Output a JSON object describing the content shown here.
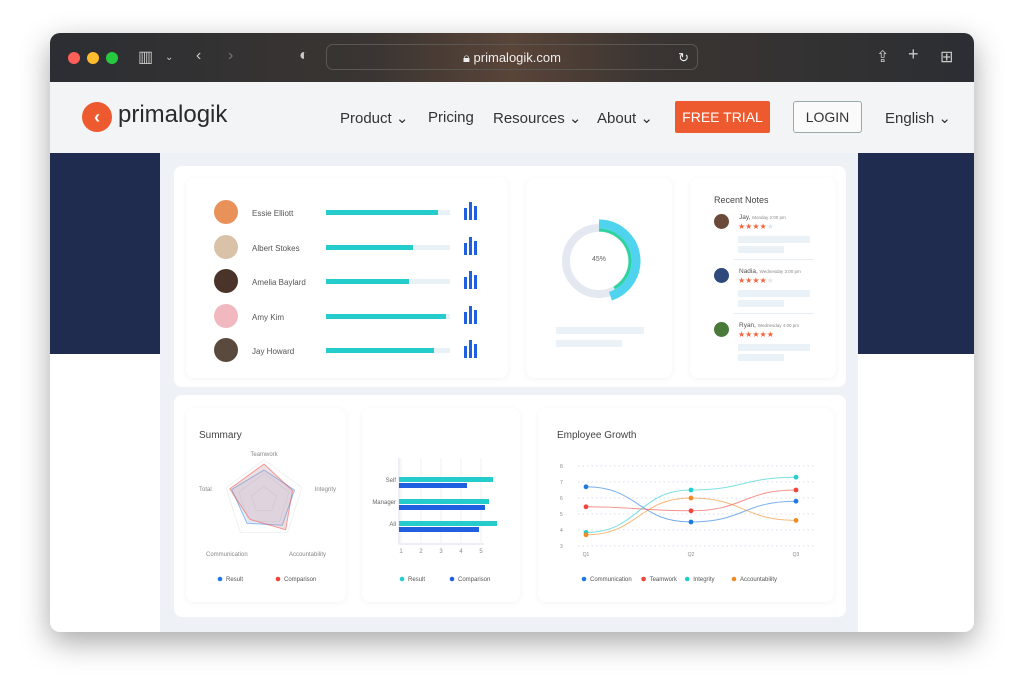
{
  "browser": {
    "url": "primalogik.com"
  },
  "nav": {
    "brand": "primalogik",
    "items": [
      "Product",
      "Pricing",
      "Resources",
      "About"
    ],
    "free_trial": "FREE TRIAL",
    "login": "LOGIN",
    "language": "English"
  },
  "colors": {
    "accent": "#ee5a2f",
    "teal": "#24cccc",
    "blue": "#1f5fe0",
    "hero": "#1f2b4f"
  },
  "people": [
    {
      "name": "Essie Elliott",
      "progress": 0.9
    },
    {
      "name": "Albert Stokes",
      "progress": 0.7
    },
    {
      "name": "Amelia Baylard",
      "progress": 0.67
    },
    {
      "name": "Amy Kim",
      "progress": 0.97
    },
    {
      "name": "Jay Howard",
      "progress": 0.87
    }
  ],
  "donut": {
    "label": "45%",
    "value": 0.45
  },
  "notes": {
    "title": "Recent Notes",
    "items": [
      {
        "name": "Jay,",
        "time": "Monday 2:00 pm",
        "stars": 4
      },
      {
        "name": "Nadia,",
        "time": "Wednesday 3:00 pm",
        "stars": 4
      },
      {
        "name": "Ryan,",
        "time": "Wednesday 4:00 pm",
        "stars": 5
      }
    ]
  },
  "summary": {
    "title": "Summary",
    "axes": [
      "Teamwork",
      "Integrity",
      "Accountability",
      "Communication",
      "Total"
    ],
    "series": [
      {
        "name": "Result",
        "color": "#1f7ae0",
        "values": [
          0.75,
          0.8,
          0.78,
          0.72,
          0.85
        ]
      },
      {
        "name": "Comparison",
        "color": "#f0443c",
        "values": [
          0.9,
          0.75,
          0.92,
          0.6,
          0.9
        ]
      }
    ]
  },
  "bars": {
    "categories": [
      "Self",
      "Manager",
      "All"
    ],
    "ticks": [
      "1",
      "2",
      "3",
      "4",
      "5"
    ],
    "series": [
      {
        "name": "Result",
        "color": "#24cccc",
        "values": [
          5.6,
          5.4,
          5.8
        ]
      },
      {
        "name": "Comparison",
        "color": "#1f5fe0",
        "values": [
          4.3,
          5.2,
          4.9
        ]
      }
    ]
  },
  "growth": {
    "title": "Employee Growth",
    "x": [
      "Q1",
      "Q2",
      "Q3"
    ],
    "yticks": [
      "3",
      "4",
      "5",
      "6",
      "7",
      "8"
    ],
    "series": [
      {
        "name": "Communication",
        "color": "#1f7ae0",
        "values": [
          6.7,
          4.5,
          5.8
        ]
      },
      {
        "name": "Teamwork",
        "color": "#f0443c",
        "values": [
          5.45,
          5.2,
          6.5
        ]
      },
      {
        "name": "Integrity",
        "color": "#24cccc",
        "values": [
          3.85,
          6.5,
          7.3
        ]
      },
      {
        "name": "Accountability",
        "color": "#f08a24",
        "values": [
          3.7,
          6.0,
          4.6
        ]
      }
    ]
  }
}
